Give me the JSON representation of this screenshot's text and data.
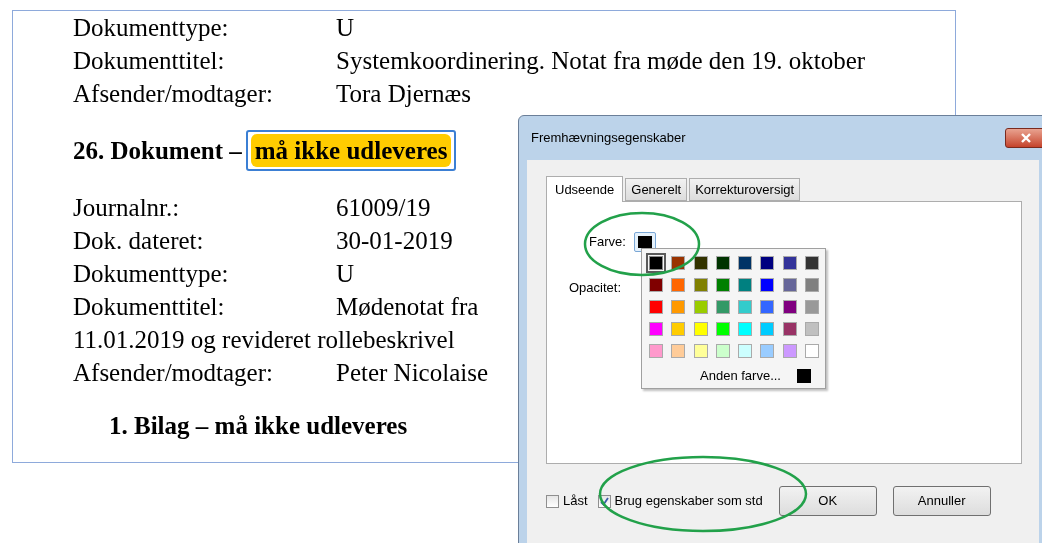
{
  "document": {
    "top_fields": [
      {
        "label": "Dokumenttype:",
        "value": "U"
      },
      {
        "label": "Dokumenttitel:",
        "value": "Systemkoordinering. Notat fra møde den 19. oktober"
      },
      {
        "label": "Afsender/modtager:",
        "value": "Tora Djernæs"
      }
    ],
    "heading": {
      "text": "26. Dokument –",
      "highlight": "må ikke udleveres"
    },
    "fields": [
      {
        "label": "Journalnr.:",
        "value": "61009/19"
      },
      {
        "label": "Dok. dateret:",
        "value": "30-01-2019"
      },
      {
        "label": "Dokumenttype:",
        "value": "U"
      },
      {
        "label": "Dokumenttitel:",
        "value": "Mødenotat fra"
      }
    ],
    "continuation": "11.01.2019 og revideret rollebeskrivel",
    "last_field": {
      "label": "Afsender/modtager:",
      "value": "Peter Nicolaise"
    },
    "subheading": "1. Bilag – må ikke udleveres"
  },
  "dialog": {
    "title": "Fremhævningsegenskaber",
    "tabs": [
      {
        "label": "Udseende",
        "selected": true
      },
      {
        "label": "Generelt",
        "selected": false
      },
      {
        "label": "Korrekturoversigt",
        "selected": false
      }
    ],
    "color_label": "Farve:",
    "color_button": {
      "color": "#000000"
    },
    "opacity_label": "Opacitet:",
    "palette": [
      {
        "color": "#000000",
        "selected": true
      },
      {
        "color": "#993300",
        "selected": false
      },
      {
        "color": "#333300",
        "selected": false
      },
      {
        "color": "#003300",
        "selected": false
      },
      {
        "color": "#003366",
        "selected": false
      },
      {
        "color": "#000080",
        "selected": false
      },
      {
        "color": "#333399",
        "selected": false
      },
      {
        "color": "#333333",
        "selected": false
      },
      {
        "color": "#800000",
        "selected": false
      },
      {
        "color": "#ff6600",
        "selected": false
      },
      {
        "color": "#808000",
        "selected": false
      },
      {
        "color": "#008000",
        "selected": false
      },
      {
        "color": "#008080",
        "selected": false
      },
      {
        "color": "#0000ff",
        "selected": false
      },
      {
        "color": "#666699",
        "selected": false
      },
      {
        "color": "#808080",
        "selected": false
      },
      {
        "color": "#ff0000",
        "selected": false
      },
      {
        "color": "#ff9900",
        "selected": false
      },
      {
        "color": "#99cc00",
        "selected": false
      },
      {
        "color": "#339966",
        "selected": false
      },
      {
        "color": "#33cccc",
        "selected": false
      },
      {
        "color": "#3366ff",
        "selected": false
      },
      {
        "color": "#800080",
        "selected": false
      },
      {
        "color": "#999999",
        "selected": false
      },
      {
        "color": "#ff00ff",
        "selected": false
      },
      {
        "color": "#ffcc00",
        "selected": false
      },
      {
        "color": "#ffff00",
        "selected": false
      },
      {
        "color": "#00ff00",
        "selected": false
      },
      {
        "color": "#00ffff",
        "selected": false
      },
      {
        "color": "#00ccff",
        "selected": false
      },
      {
        "color": "#993366",
        "selected": false
      },
      {
        "color": "#c0c0c0",
        "selected": false
      },
      {
        "color": "#ff99cc",
        "selected": false
      },
      {
        "color": "#ffcc99",
        "selected": false
      },
      {
        "color": "#ffff99",
        "selected": false
      },
      {
        "color": "#ccffcc",
        "selected": false
      },
      {
        "color": "#ccffff",
        "selected": false
      },
      {
        "color": "#99ccff",
        "selected": false
      },
      {
        "color": "#cc99ff",
        "selected": false
      },
      {
        "color": "#ffffff",
        "selected": false
      }
    ],
    "other_color": {
      "label": "Anden farve...",
      "color": "#000000"
    },
    "checkboxes": [
      {
        "label": "Låst",
        "checked": false
      },
      {
        "label": "Brug egenskaber som std",
        "checked": true
      }
    ],
    "buttons": [
      "OK",
      "Annuller"
    ]
  }
}
